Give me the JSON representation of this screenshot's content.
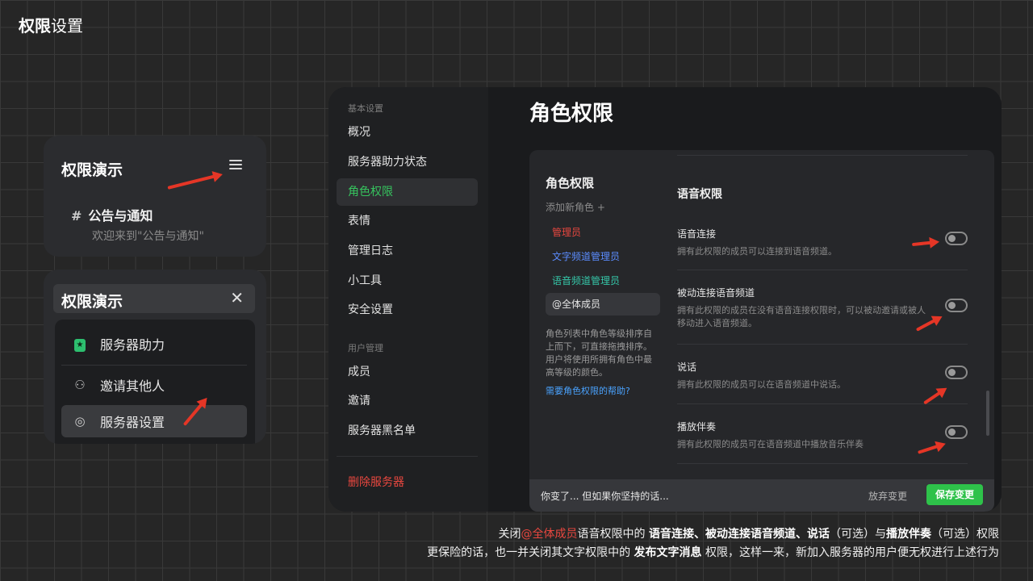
{
  "page_title": {
    "bold": "权限",
    "rest": "设置"
  },
  "card1": {
    "title": "权限演示",
    "channel": "公告与通知",
    "channel_desc": "欢迎来到\"公告与通知\""
  },
  "card2": {
    "title": "权限演示",
    "items": [
      {
        "label": "服务器助力",
        "icon": "boost-icon"
      },
      {
        "label": "邀请其他人",
        "icon": "invite-user-icon"
      },
      {
        "label": "服务器设置",
        "icon": "settings-icon"
      }
    ]
  },
  "sidebar": {
    "section1": "基本设置",
    "items1": [
      "概况",
      "服务器助力状态",
      "角色权限",
      "表情",
      "管理日志",
      "小工具",
      "安全设置"
    ],
    "section2": "用户管理",
    "items2": [
      "成员",
      "邀请",
      "服务器黑名单"
    ],
    "delete": "删除服务器"
  },
  "main": {
    "title": "角色权限",
    "roles_title": "角色权限",
    "add_role": "添加新角色  +",
    "roles": [
      {
        "name": "管理员",
        "color": "#e8473f"
      },
      {
        "name": "文字频道管理员",
        "color": "#5b8cff"
      },
      {
        "name": "语音频道管理员",
        "color": "#35c6a8"
      },
      {
        "name": "@全体成员",
        "color": "#e6e6e6"
      }
    ],
    "roles_hint": "角色列表中角色等级排序自上而下，可直接拖拽排序。用户将使用所拥有角色中最高等级的颜色。",
    "roles_help": "需要角色权限的帮助?",
    "voice_title": "语音权限",
    "permissions": [
      {
        "name": "语音连接",
        "desc": "拥有此权限的成员可以连接到语音频道。"
      },
      {
        "name": "被动连接语音频道",
        "desc": "拥有此权限的成员在没有语音连接权限时，可以被动邀请或被人移动进入语音频道。"
      },
      {
        "name": "说话",
        "desc": "拥有此权限的成员可以在语音频道中说话。"
      },
      {
        "name": "播放伴奏",
        "desc": "拥有此权限的成员可在语音频道中播放音乐伴奏"
      }
    ],
    "savebar": {
      "message": "你变了... 但如果你坚持的话...",
      "discard": "放弃变更",
      "save": "保存变更"
    }
  },
  "caption": {
    "line1": [
      "关闭",
      "@全体成员",
      "语音权限中的 ",
      "语音连接、被动连接语音频道、说话",
      "（可选）与",
      "播放伴奏",
      "（可选）权限"
    ],
    "line2": [
      "更保险的话，也一并关闭其文字权限中的 ",
      "发布文字消息",
      " 权限，这样一来，新加入服务器的用户便无权进行上述行为"
    ]
  }
}
